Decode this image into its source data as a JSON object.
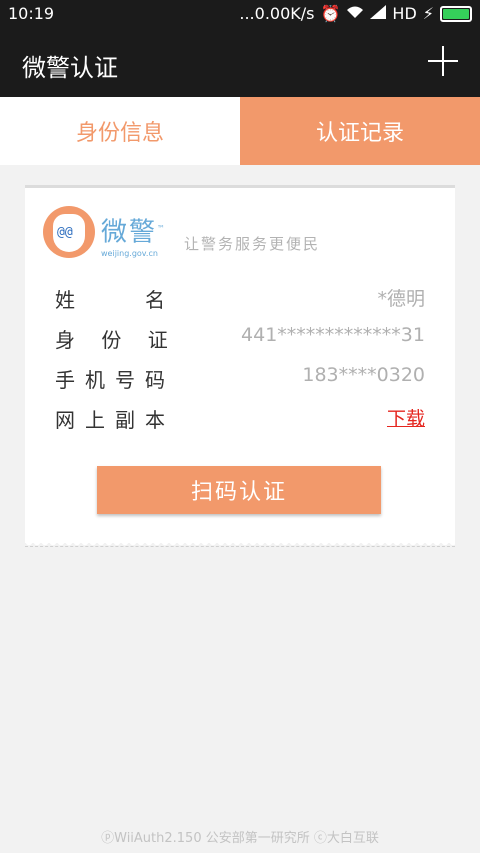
{
  "status_bar": {
    "time": "10:19",
    "speed": "...0.00K/s",
    "network": "HD",
    "icons": [
      "alarm-icon",
      "wifi-icon",
      "signal-icon",
      "charging-icon",
      "battery-icon"
    ]
  },
  "app_bar": {
    "title": "微警认证",
    "add_icon": "plus-icon"
  },
  "tabs": [
    {
      "label": "身份信息",
      "active": false
    },
    {
      "label": "认证记录",
      "active": true
    }
  ],
  "card": {
    "brand_name": "微警",
    "brand_tm": "™",
    "brand_site": "weijing.gov.cn",
    "logo_eyes": "@@",
    "slogan": "让警务服务更便民",
    "rows": [
      {
        "label": "姓　　名",
        "value": "*德明"
      },
      {
        "label": "身 份 证",
        "value": "441*************31"
      },
      {
        "label": "手机号码",
        "value": "183****0320"
      },
      {
        "label": "网上副本",
        "value": "下载"
      }
    ],
    "scan_button": "扫码认证"
  },
  "footer": "ⓟWiiAuth2.150  公安部第一研究所  ⓒ大白互联",
  "colors": {
    "accent": "#f2996b",
    "dark": "#1b1b1b",
    "link": "#e5261f",
    "brand_blue": "#66a9d8"
  }
}
